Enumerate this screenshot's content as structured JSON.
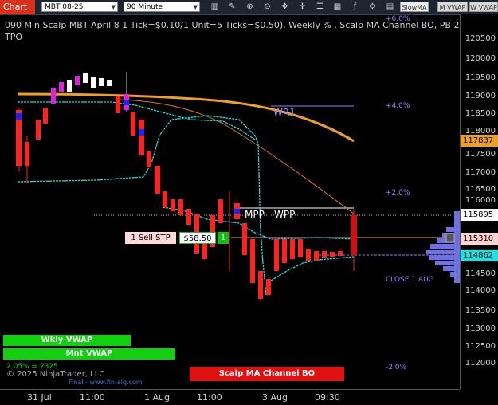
{
  "toolbar": {
    "chart_label": "Chart",
    "instrument": "MBT 08-25",
    "interval": "90 Minute",
    "indicator_buttons": [
      "SlowMA",
      "M VWAP",
      "W VWAP"
    ]
  },
  "chart": {
    "title": "090 Min Scalp MBT April 8 1 Tick=$0.10/1 Unit=5 Ticks=$0.50), Weekly % , Scalp MA Channel BO, PB 250p, Wk",
    "subtitle": "TPO",
    "copyright": "© 2025 NinjaTrader, LLC",
    "footer_text": "Final - www.fin-alg.com",
    "y_ticks": [
      "120500",
      "120000",
      "119500",
      "119000",
      "118500",
      "118000",
      "117500",
      "117000",
      "116500",
      "116000",
      "115500",
      "115000",
      "114500",
      "114000",
      "113500",
      "113000",
      "112500",
      "112000"
    ],
    "price_pills": [
      {
        "value": "117837",
        "color": "#f0a020"
      },
      {
        "value": "115895",
        "color": "#ffffff"
      },
      {
        "value": "115310",
        "color": "#ffd0d0"
      },
      {
        "value": "114862",
        "color": "#20e0e0"
      }
    ],
    "pct_labels": [
      "+6.0%",
      "+4.0%",
      "+2.0%",
      "-2.0%"
    ],
    "wr1_label": "WR1",
    "mpp_label": "MPP",
    "wpp_label": "WPP",
    "close_label": "CLOSE 1 AUG",
    "order_label": "1 Sell STP",
    "order_price": "$58.50",
    "order_qty": "1",
    "wkly_vwap": "Wkly VWAP",
    "mnt_vwap": "Mnt VWAP",
    "pct_stat": "2.05% = 2325",
    "channel_bo": "Scalp MA Channel BO",
    "x_ticks": [
      "31 Jul",
      "11:00",
      "1 Aug",
      "11:00",
      "3 Aug",
      "09:30"
    ]
  }
}
